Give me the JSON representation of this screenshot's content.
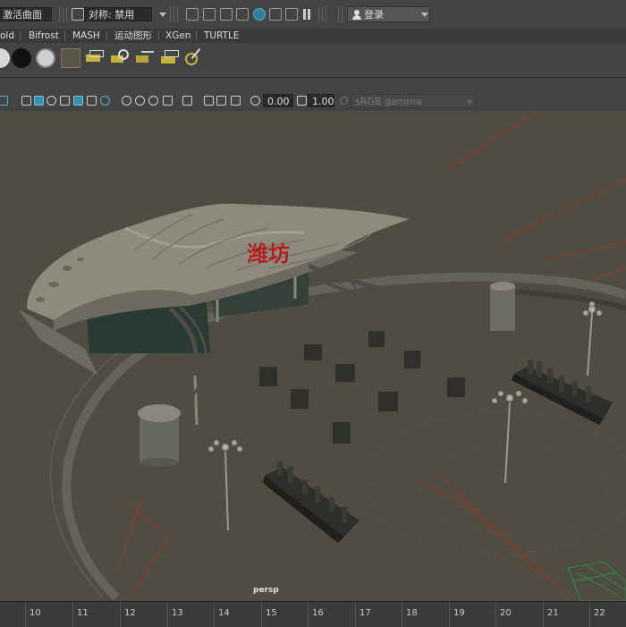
{
  "statusline": {
    "curve_field": "激活曲面",
    "symmetry_field": "对称: 禁用",
    "login_label": "登录"
  },
  "shelf_tabs": [
    "old",
    "Bifrost",
    "MASH",
    "运动图形",
    "XGen",
    "TURTLE"
  ],
  "panel_toolbar": {
    "exposure_value": "0.00",
    "gamma_value": "1.00",
    "colorspace": "sRGB gamma"
  },
  "viewport": {
    "camera_label": "persp",
    "sign_text": "潍坊",
    "colors": {
      "background": "#4f4d42",
      "sign": "#b51e1e"
    }
  },
  "timeline": {
    "ticks": [
      "10",
      "11",
      "12",
      "13",
      "14",
      "15",
      "16",
      "17",
      "18",
      "19",
      "20",
      "21",
      "22"
    ]
  }
}
